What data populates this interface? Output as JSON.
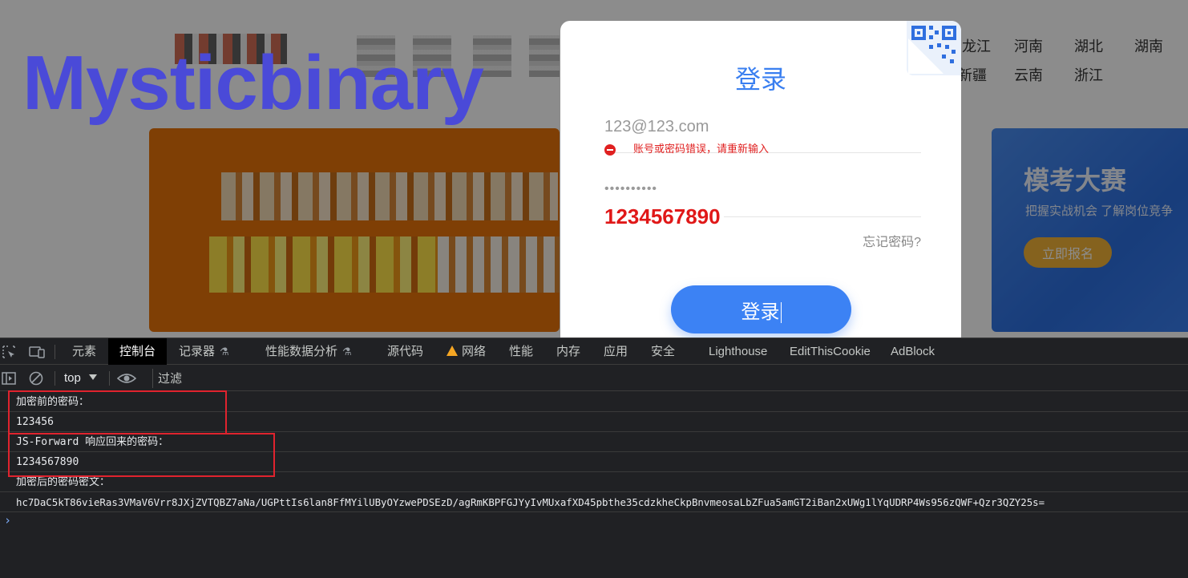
{
  "website": {
    "watermark": "Mysticbinary",
    "provinces": [
      "龙江",
      "河南",
      "湖北",
      "湖南",
      "新疆",
      "云南",
      "浙江"
    ],
    "promo": {
      "title": "模考大赛",
      "subtitle": "把握实战机会  了解岗位竞争",
      "button": "立即报名"
    }
  },
  "login": {
    "title": "登录",
    "account_value": "123@123.com",
    "error_message": "账号或密码错误，请重新输入",
    "password_mask": "••••••••••",
    "password_plain": "1234567890",
    "forgot_label": "忘记密码?",
    "submit_label": "登录"
  },
  "devtools": {
    "tabs": [
      {
        "label": "元素"
      },
      {
        "label": "控制台",
        "active": true
      },
      {
        "label": "记录器"
      },
      {
        "label": "性能数据分析"
      },
      {
        "label": "源代码"
      },
      {
        "label": "网络"
      },
      {
        "label": "性能"
      },
      {
        "label": "内存"
      },
      {
        "label": "应用"
      },
      {
        "label": "安全"
      },
      {
        "label": "Lighthouse"
      },
      {
        "label": "EditThisCookie"
      },
      {
        "label": "AdBlock"
      }
    ],
    "context": "top",
    "filter_placeholder": "过滤",
    "logs": [
      "加密前的密码：",
      "123456",
      "JS-Forward 响应回来的密码：",
      "1234567890",
      "加密后的密码密文：",
      "hc7DaC5kT86vieRas3VMaV6Vrr8JXjZVTQBZ7aNa/UGPttIs6lan8FfMYilUByOYzwePDSEzD/agRmKBPFGJYyIvMUxafXD45pbthe35cdzkheCkpBnvmeosaLbZFua5amGT2iBan2xUWg1lYqUDRP4Ws956zQWF+Qzr3QZY25s="
    ],
    "prompt": "›"
  },
  "colors": {
    "accent": "#3c82f4",
    "error": "#e02020",
    "highlight_box": "#e0232e",
    "devtools_bg": "#202124"
  }
}
